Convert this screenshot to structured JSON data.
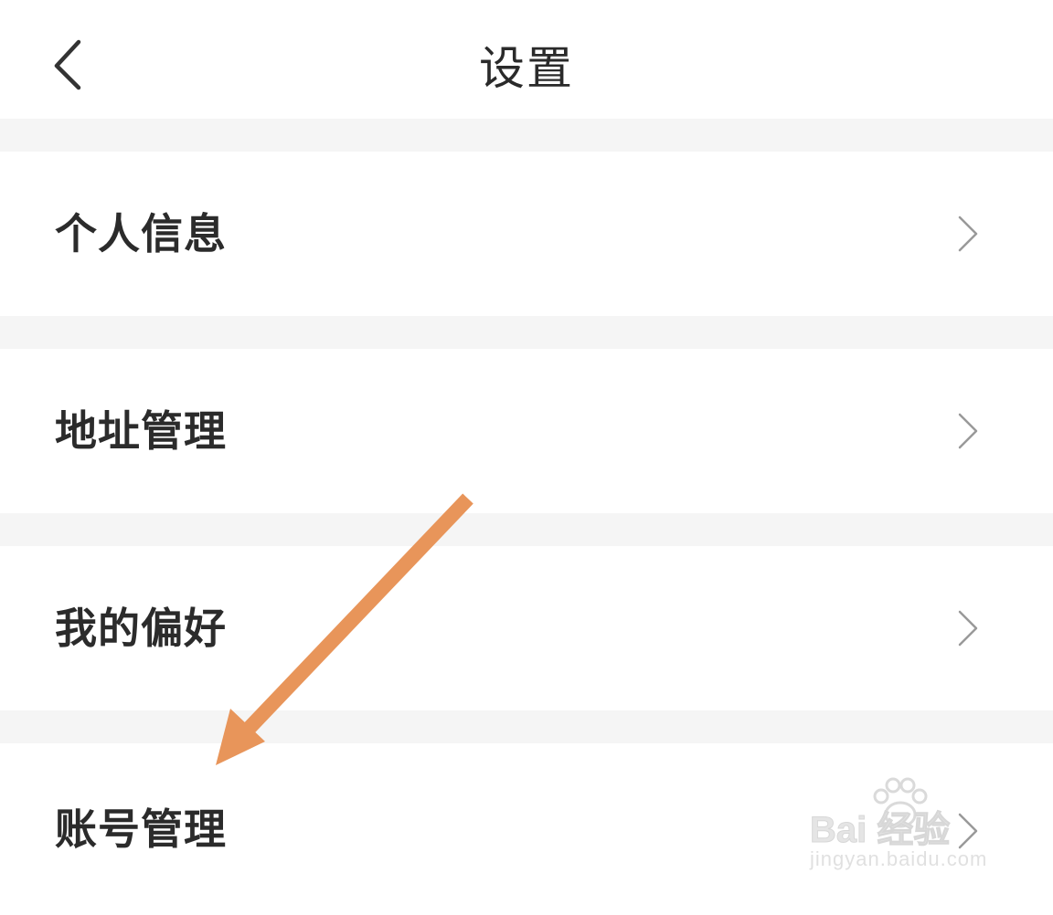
{
  "header": {
    "title": "设置",
    "back_icon": "chevron-left-icon"
  },
  "settings": {
    "items": [
      {
        "label": "个人信息",
        "icon": "chevron-right-icon"
      },
      {
        "label": "地址管理",
        "icon": "chevron-right-icon"
      },
      {
        "label": "我的偏好",
        "icon": "chevron-right-icon"
      },
      {
        "label": "账号管理",
        "icon": "chevron-right-icon"
      }
    ]
  },
  "annotation": {
    "type": "arrow",
    "color": "#E8955A",
    "target": "账号管理"
  },
  "watermark": {
    "brand": "Bai 经验",
    "url": "jingyan.baidu.com"
  },
  "colors": {
    "background": "#ffffff",
    "separator": "#f5f5f5",
    "text": "#2b2b2b",
    "chevron": "#999999"
  }
}
